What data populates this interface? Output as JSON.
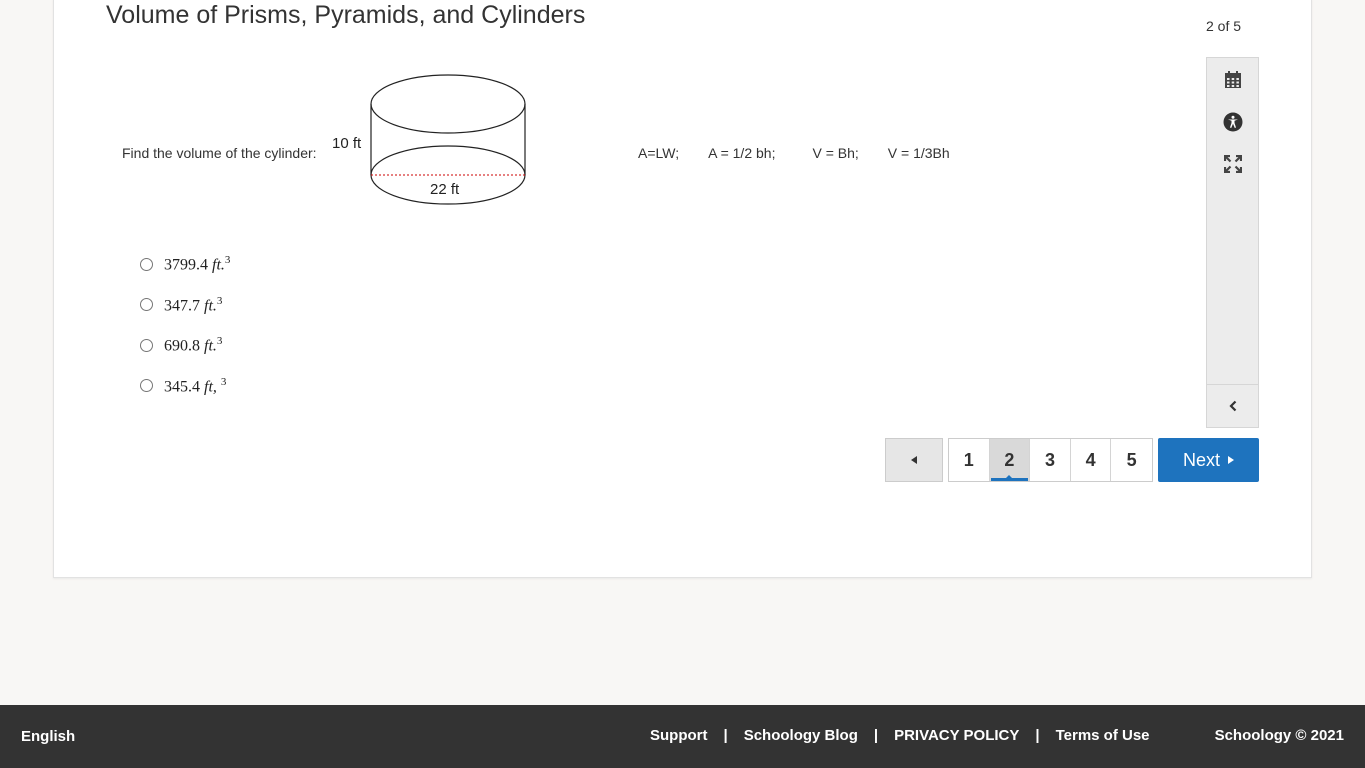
{
  "assessment": {
    "title": "Volume of Prisms, Pyramids, and Cylinders",
    "progress": "2 of 5"
  },
  "question": {
    "prompt": "Find the volume of the cylinder:",
    "figure": {
      "height_label": "10 ft",
      "diameter_label": "22 ft"
    },
    "formulas": [
      "A=LW;",
      "A = 1/2 bh;",
      "V = Bh;",
      "V = 1/3Bh"
    ],
    "choices": [
      {
        "number": "3799.4",
        "unit": "ft.",
        "exp": "3",
        "selected": false
      },
      {
        "number": "347.7",
        "unit": "ft.",
        "exp": "3",
        "selected": false
      },
      {
        "number": "690.8",
        "unit": "ft.",
        "exp": "3",
        "selected": false
      },
      {
        "number": "345.4",
        "unit": "ft,",
        "exp": "3",
        "selected": false
      }
    ]
  },
  "toolbar": {
    "tools": [
      "calendar-icon",
      "accessibility-icon",
      "fullscreen-icon"
    ],
    "collapse": "chevron-left-icon"
  },
  "pagination": {
    "pages": [
      "1",
      "2",
      "3",
      "4",
      "5"
    ],
    "current": "2",
    "next_label": "Next"
  },
  "footer": {
    "language": "English",
    "links": [
      "Support",
      "Schoology Blog",
      "PRIVACY POLICY",
      "Terms of Use"
    ],
    "copyright": "Schoology © 2021"
  },
  "colors": {
    "primary": "#1e73be",
    "footer_bg": "#333333",
    "dashed_line": "#cc0000"
  }
}
